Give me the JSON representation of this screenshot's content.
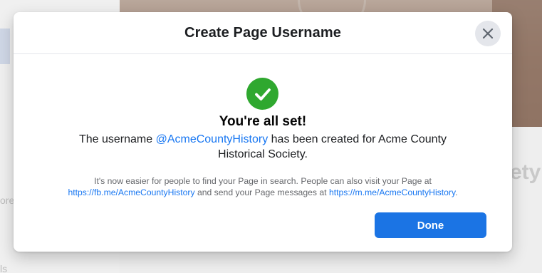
{
  "dialog": {
    "title": "Create Page Username",
    "close_icon": "close-icon"
  },
  "success": {
    "icon": "checkmark-circle-icon",
    "icon_color": "#2fa82f",
    "heading": "You're all set!",
    "message_before": "The username ",
    "username": "@AcmeCountyHistory",
    "message_after": " has been created for Acme County Historical Society."
  },
  "info": {
    "text_1": "It's now easier for people to find your Page in search. People can also visit your Page at ",
    "link_fb": "https://fb.me/AcmeCountyHistory",
    "text_2": " and send your Page messages at ",
    "link_m": "https://m.me/AcmeCountyHistory",
    "text_3": "."
  },
  "actions": {
    "done_label": "Done",
    "done_color": "#1b74e4"
  },
  "background": {
    "fragment_more": "ore",
    "fragment_ety": "ety",
    "fragment_ls": "ls"
  },
  "colors": {
    "link": "#1877f2",
    "title_text": "#1c1e21",
    "secondary_text": "#65676b"
  }
}
